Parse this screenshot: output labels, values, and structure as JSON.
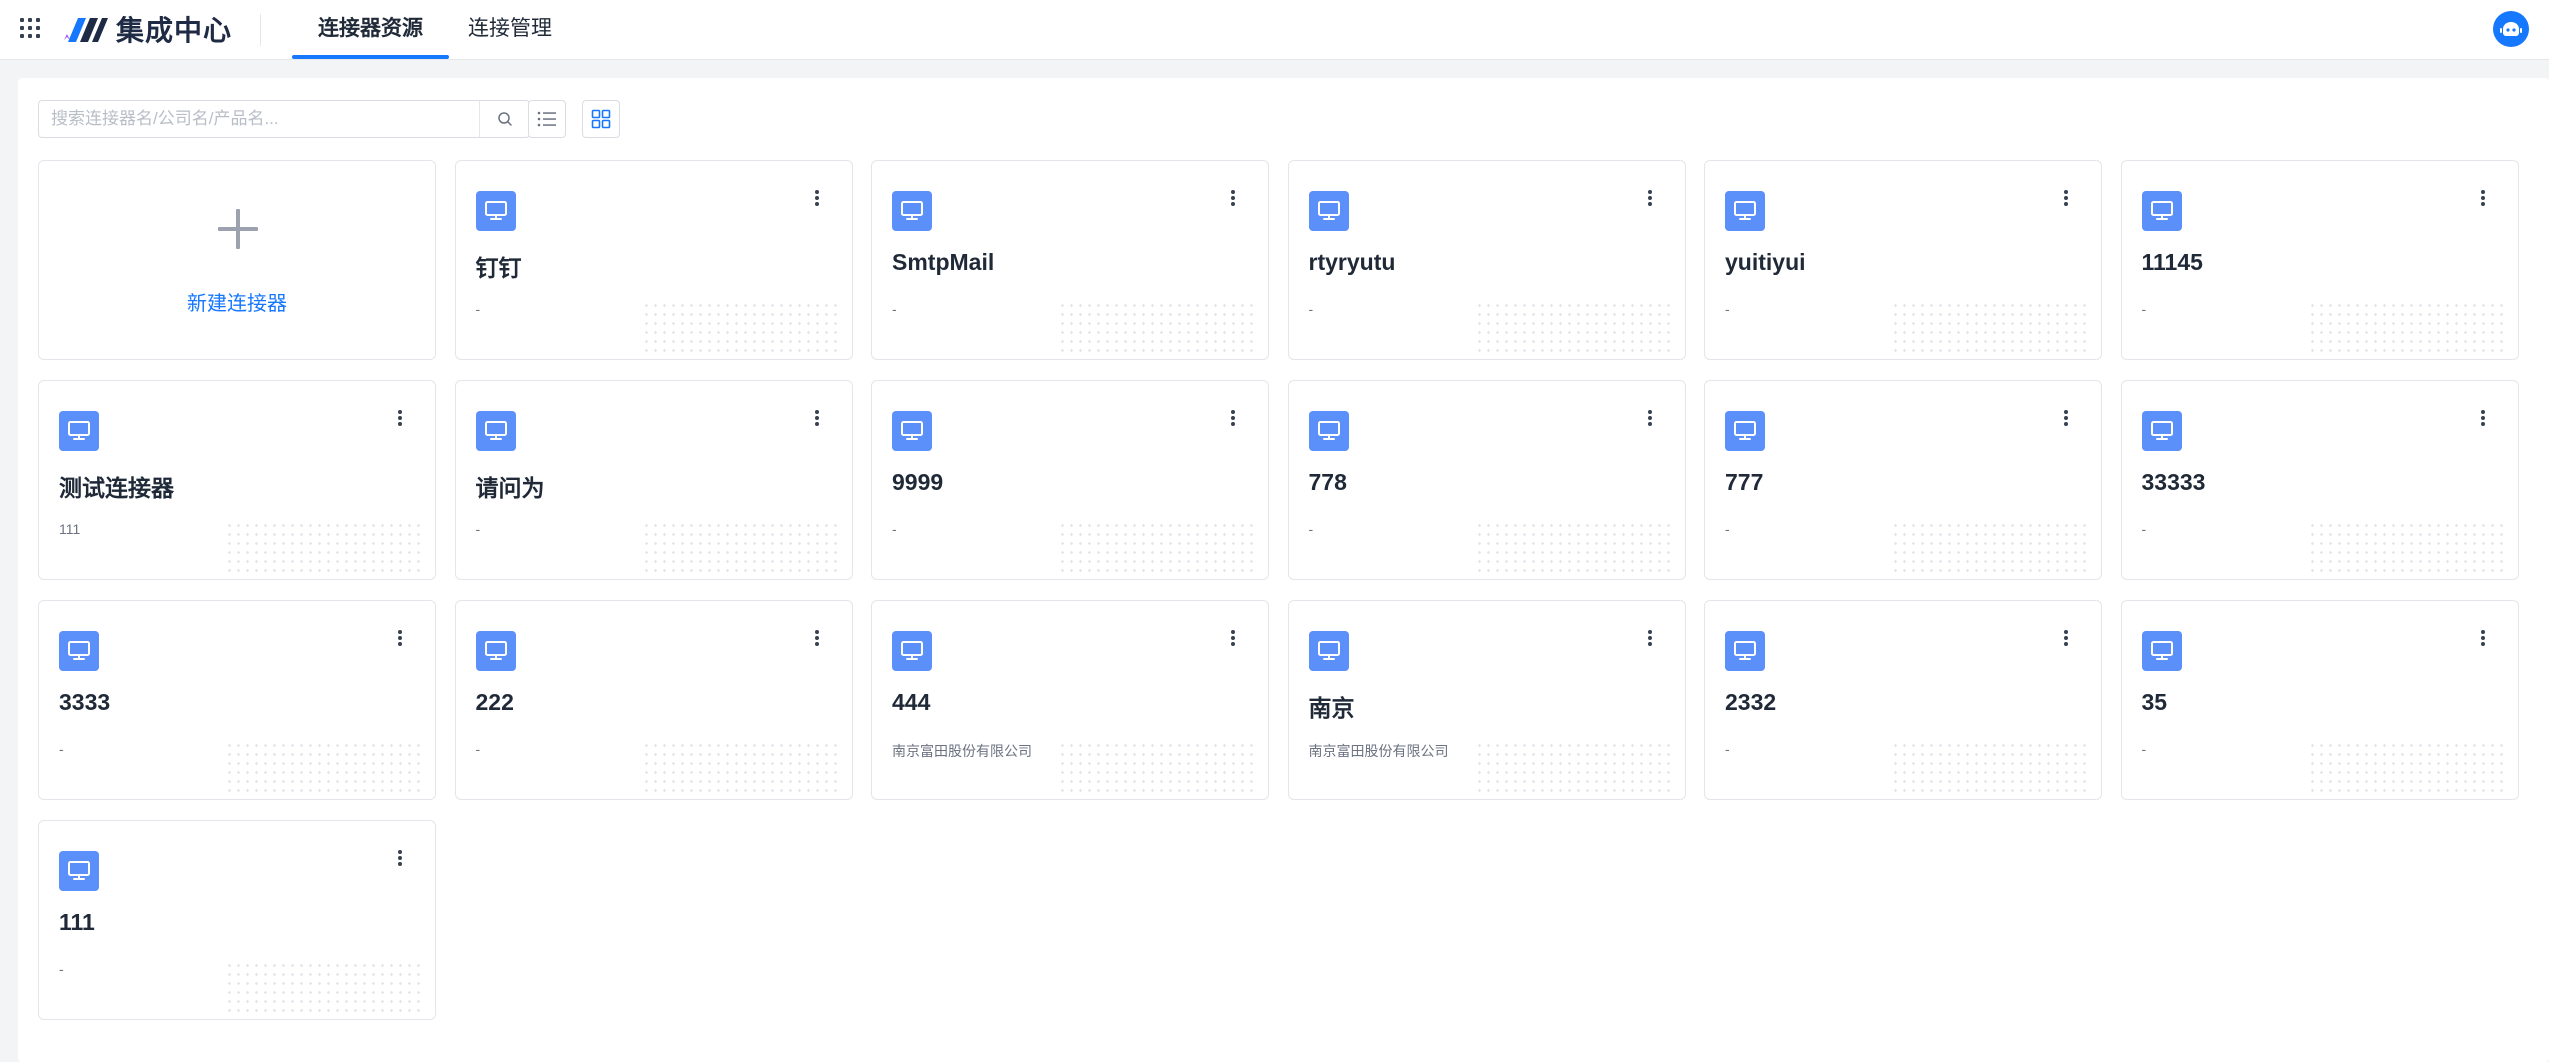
{
  "header": {
    "app_title": "集成中心",
    "tabs": [
      {
        "label": "连接器资源",
        "active": true
      },
      {
        "label": "连接管理",
        "active": false
      }
    ]
  },
  "search": {
    "placeholder": "搜索连接器名/公司名/产品名..."
  },
  "add_card": {
    "label": "新建连接器"
  },
  "connectors": [
    {
      "name": "钉钉",
      "desc": "-"
    },
    {
      "name": "SmtpMail",
      "desc": "-"
    },
    {
      "name": "rtyryutu",
      "desc": "-"
    },
    {
      "name": "yuitiyui",
      "desc": "-"
    },
    {
      "name": "11145",
      "desc": "-"
    },
    {
      "name": "测试连接器",
      "desc": "111"
    },
    {
      "name": "请问为",
      "desc": "-"
    },
    {
      "name": "9999",
      "desc": "-"
    },
    {
      "name": "778",
      "desc": "-"
    },
    {
      "name": "777",
      "desc": "-"
    },
    {
      "name": "33333",
      "desc": "-"
    },
    {
      "name": "3333",
      "desc": "-"
    },
    {
      "name": "222",
      "desc": "-"
    },
    {
      "name": "444",
      "desc": "南京富田股份有限公司"
    },
    {
      "name": "南京",
      "desc": "南京富田股份有限公司"
    },
    {
      "name": "2332",
      "desc": "-"
    },
    {
      "name": "35",
      "desc": "-"
    },
    {
      "name": "111",
      "desc": "-"
    }
  ],
  "icons": {
    "apps": "apps-grid-icon",
    "search": "search-icon",
    "list_view": "list-view-icon",
    "grid_view": "grid-view-icon",
    "connector": "monitor-icon",
    "more": "more-vertical-icon",
    "avatar": "robot-icon"
  },
  "colors": {
    "accent": "#1677ff",
    "connector_icon_bg": "#5b8ff9",
    "logo_dark": "#1f2a44"
  }
}
